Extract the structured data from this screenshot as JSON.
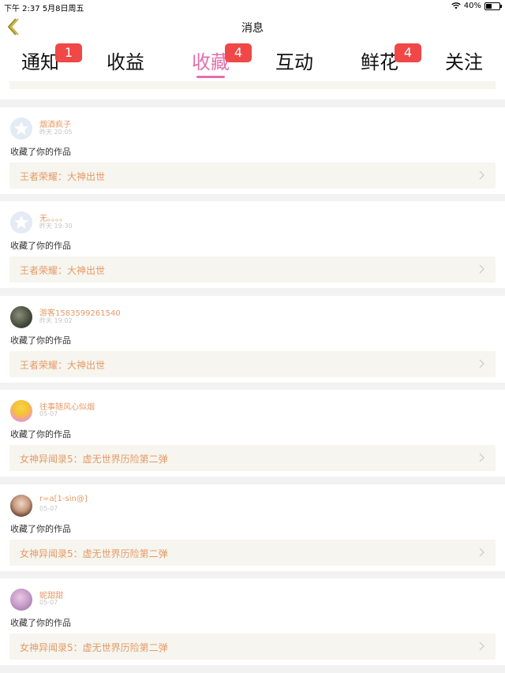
{
  "status_bar": {
    "time": "下午 2:37   5月8日周五",
    "battery": "40%"
  },
  "nav": {
    "title": "消息",
    "back_icon": "chevron-left-icon"
  },
  "tabs": [
    {
      "label": "通知",
      "badge": "1"
    },
    {
      "label": "收益",
      "badge": ""
    },
    {
      "label": "收藏",
      "badge": "4",
      "active": true
    },
    {
      "label": "互动",
      "badge": ""
    },
    {
      "label": "鲜花",
      "badge": "4"
    },
    {
      "label": "关注",
      "badge": ""
    }
  ],
  "colors": {
    "accent": "#e56fae",
    "badge": "#f04747",
    "name": "#e59a66",
    "card_bg": "#f6f5ef"
  },
  "items": [
    {
      "user": "烟酒疯子",
      "time": "昨天 20:05",
      "action": "收藏了你的作品",
      "work": "王者荣耀：大神出世",
      "avatar": "default-avatar"
    },
    {
      "user": "无。。。。",
      "time": "昨天 19:30",
      "action": "收藏了你的作品",
      "work": "王者荣耀：大神出世",
      "avatar": "default-avatar"
    },
    {
      "user": "游客1583599261540",
      "time": "昨天 19:02",
      "action": "收藏了你的作品",
      "work": "王者荣耀：大神出世",
      "avatar": "photo-avatar"
    },
    {
      "user": "往事随风心似烟",
      "time": "05-07",
      "action": "收藏了你的作品",
      "work": "女神异闻录5：虚无世界历险第二弹",
      "avatar": "photo-avatar"
    },
    {
      "user": "r=a[1-sin@]",
      "time": "05-07",
      "action": "收藏了你的作品",
      "work": "女神异闻录5：虚无世界历险第二弹",
      "avatar": "photo-avatar"
    },
    {
      "user": "妮甜甜",
      "time": "05-07",
      "action": "收藏了你的作品",
      "work": "女神异闻录5：虚无世界历险第二弹",
      "avatar": "photo-avatar"
    }
  ]
}
